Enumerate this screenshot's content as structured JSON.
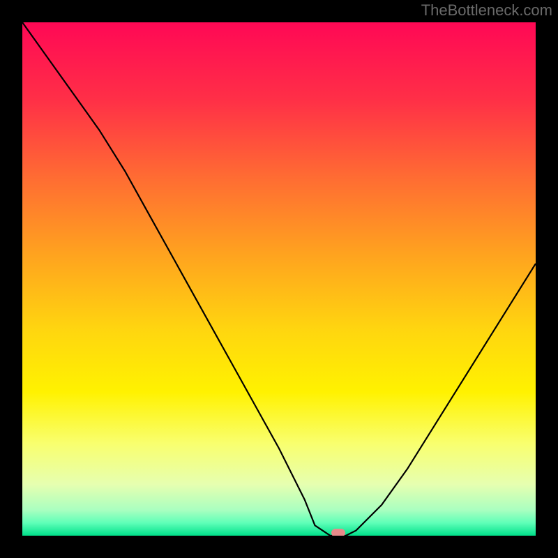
{
  "watermark": "TheBottleneck.com",
  "chart_data": {
    "type": "line",
    "title": "",
    "xlabel": "",
    "ylabel": "",
    "xlim": [
      0,
      100
    ],
    "ylim": [
      0,
      100
    ],
    "x": [
      0,
      5,
      10,
      15,
      20,
      25,
      30,
      35,
      40,
      45,
      50,
      55,
      57,
      60,
      63,
      65,
      70,
      75,
      80,
      85,
      90,
      95,
      100
    ],
    "values": [
      100,
      93,
      86,
      79,
      71,
      62,
      53,
      44,
      35,
      26,
      17,
      7,
      2,
      0,
      0,
      1,
      6,
      13,
      21,
      29,
      37,
      45,
      53
    ],
    "gradient_stops": [
      {
        "pos": 0.0,
        "color": "#ff0855"
      },
      {
        "pos": 0.15,
        "color": "#ff2f47"
      },
      {
        "pos": 0.3,
        "color": "#ff6b33"
      },
      {
        "pos": 0.45,
        "color": "#ffa21f"
      },
      {
        "pos": 0.6,
        "color": "#ffd60f"
      },
      {
        "pos": 0.72,
        "color": "#fff200"
      },
      {
        "pos": 0.82,
        "color": "#f9ff6e"
      },
      {
        "pos": 0.9,
        "color": "#e6ffb0"
      },
      {
        "pos": 0.95,
        "color": "#aaffc0"
      },
      {
        "pos": 0.975,
        "color": "#5fffb8"
      },
      {
        "pos": 1.0,
        "color": "#00e08a"
      }
    ],
    "marker": {
      "x": 61.5,
      "y": 0,
      "color": "#e78a8a"
    }
  }
}
